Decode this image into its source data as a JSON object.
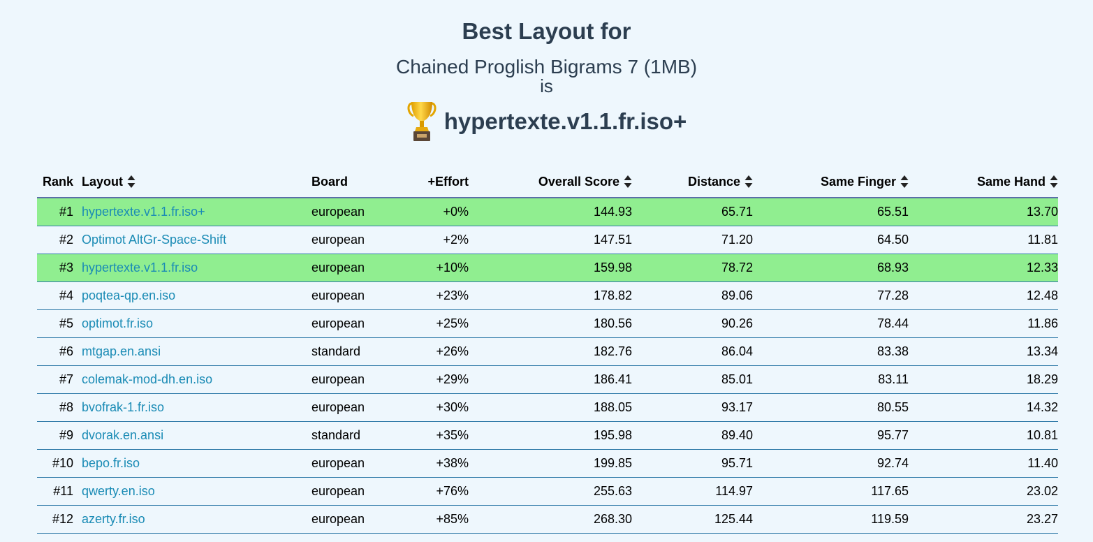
{
  "header": {
    "title": "Best Layout for",
    "corpus": "Chained Proglish Bigrams 7 (1MB)",
    "connector": "is",
    "winner": "hypertexte.v1.1.fr.iso+",
    "winner_icon": "trophy-icon"
  },
  "table": {
    "columns": {
      "rank": "Rank",
      "layout": "Layout",
      "board": "Board",
      "effort": "+Effort",
      "overall": "Overall Score",
      "distance": "Distance",
      "same_finger": "Same Finger",
      "same_hand": "Same Hand"
    },
    "sortable_icon": "sort-updown-icon",
    "highlight_color": "#90ee90",
    "link_color": "#1a8bb5",
    "rows": [
      {
        "rank": "#1",
        "layout": "hypertexte.v1.1.fr.iso+",
        "board": "european",
        "effort": "+0%",
        "overall": "144.93",
        "distance": "65.71",
        "same_finger": "65.51",
        "same_hand": "13.70",
        "highlighted": true
      },
      {
        "rank": "#2",
        "layout": "Optimot AltGr-Space-Shift",
        "board": "european",
        "effort": "+2%",
        "overall": "147.51",
        "distance": "71.20",
        "same_finger": "64.50",
        "same_hand": "11.81",
        "highlighted": false
      },
      {
        "rank": "#3",
        "layout": "hypertexte.v1.1.fr.iso",
        "board": "european",
        "effort": "+10%",
        "overall": "159.98",
        "distance": "78.72",
        "same_finger": "68.93",
        "same_hand": "12.33",
        "highlighted": true
      },
      {
        "rank": "#4",
        "layout": "poqtea-qp.en.iso",
        "board": "european",
        "effort": "+23%",
        "overall": "178.82",
        "distance": "89.06",
        "same_finger": "77.28",
        "same_hand": "12.48",
        "highlighted": false
      },
      {
        "rank": "#5",
        "layout": "optimot.fr.iso",
        "board": "european",
        "effort": "+25%",
        "overall": "180.56",
        "distance": "90.26",
        "same_finger": "78.44",
        "same_hand": "11.86",
        "highlighted": false
      },
      {
        "rank": "#6",
        "layout": "mtgap.en.ansi",
        "board": "standard",
        "effort": "+26%",
        "overall": "182.76",
        "distance": "86.04",
        "same_finger": "83.38",
        "same_hand": "13.34",
        "highlighted": false
      },
      {
        "rank": "#7",
        "layout": "colemak-mod-dh.en.iso",
        "board": "european",
        "effort": "+29%",
        "overall": "186.41",
        "distance": "85.01",
        "same_finger": "83.11",
        "same_hand": "18.29",
        "highlighted": false
      },
      {
        "rank": "#8",
        "layout": "bvofrak-1.fr.iso",
        "board": "european",
        "effort": "+30%",
        "overall": "188.05",
        "distance": "93.17",
        "same_finger": "80.55",
        "same_hand": "14.32",
        "highlighted": false
      },
      {
        "rank": "#9",
        "layout": "dvorak.en.ansi",
        "board": "standard",
        "effort": "+35%",
        "overall": "195.98",
        "distance": "89.40",
        "same_finger": "95.77",
        "same_hand": "10.81",
        "highlighted": false
      },
      {
        "rank": "#10",
        "layout": "bepo.fr.iso",
        "board": "european",
        "effort": "+38%",
        "overall": "199.85",
        "distance": "95.71",
        "same_finger": "92.74",
        "same_hand": "11.40",
        "highlighted": false
      },
      {
        "rank": "#11",
        "layout": "qwerty.en.iso",
        "board": "european",
        "effort": "+76%",
        "overall": "255.63",
        "distance": "114.97",
        "same_finger": "117.65",
        "same_hand": "23.02",
        "highlighted": false
      },
      {
        "rank": "#12",
        "layout": "azerty.fr.iso",
        "board": "european",
        "effort": "+85%",
        "overall": "268.30",
        "distance": "125.44",
        "same_finger": "119.59",
        "same_hand": "23.27",
        "highlighted": false
      }
    ]
  }
}
